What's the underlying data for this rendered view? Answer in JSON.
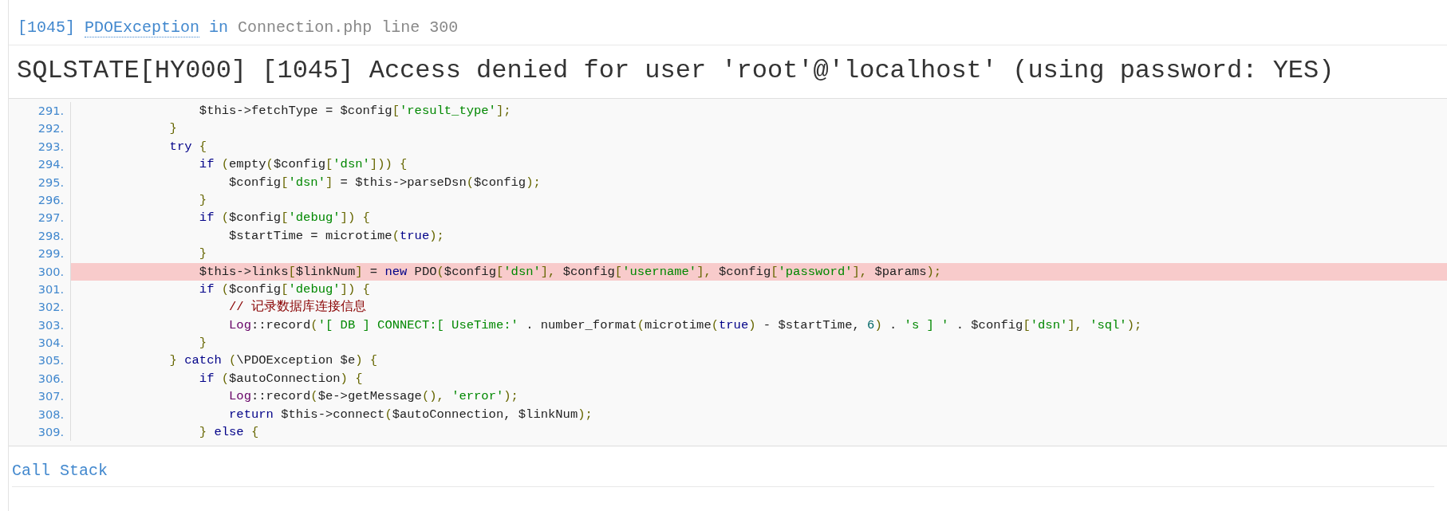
{
  "exception_header": {
    "code": "[1045]",
    "exception": "PDOException",
    "connector": "in",
    "location": "Connection.php line 300"
  },
  "message": "SQLSTATE[HY000] [1045] Access denied for user 'root'@'localhost' (using password: YES)",
  "source_lines": [
    {
      "number": "291.",
      "highlighted": false,
      "tokens": [
        {
          "kind": "pln",
          "text": "                $this->fetchType = $config"
        },
        {
          "kind": "pun",
          "text": "["
        },
        {
          "kind": "str",
          "text": "'result_type'"
        },
        {
          "kind": "pun",
          "text": "];"
        }
      ]
    },
    {
      "number": "292.",
      "highlighted": false,
      "tokens": [
        {
          "kind": "pun",
          "text": "            }"
        }
      ]
    },
    {
      "number": "293.",
      "highlighted": false,
      "tokens": [
        {
          "kind": "kwd",
          "text": "            try "
        },
        {
          "kind": "pun",
          "text": "{"
        }
      ]
    },
    {
      "number": "294.",
      "highlighted": false,
      "tokens": [
        {
          "kind": "kwd",
          "text": "                if "
        },
        {
          "kind": "pun",
          "text": "("
        },
        {
          "kind": "pln",
          "text": "empty"
        },
        {
          "kind": "pun",
          "text": "("
        },
        {
          "kind": "pln",
          "text": "$config"
        },
        {
          "kind": "pun",
          "text": "["
        },
        {
          "kind": "str",
          "text": "'dsn'"
        },
        {
          "kind": "pun",
          "text": "])) {"
        }
      ]
    },
    {
      "number": "295.",
      "highlighted": false,
      "tokens": [
        {
          "kind": "pln",
          "text": "                    $config"
        },
        {
          "kind": "pun",
          "text": "["
        },
        {
          "kind": "str",
          "text": "'dsn'"
        },
        {
          "kind": "pun",
          "text": "]"
        },
        {
          "kind": "pln",
          "text": " = $this->parseDsn"
        },
        {
          "kind": "pun",
          "text": "("
        },
        {
          "kind": "pln",
          "text": "$config"
        },
        {
          "kind": "pun",
          "text": ");"
        }
      ]
    },
    {
      "number": "296.",
      "highlighted": false,
      "tokens": [
        {
          "kind": "pun",
          "text": "                }"
        }
      ]
    },
    {
      "number": "297.",
      "highlighted": false,
      "tokens": [
        {
          "kind": "kwd",
          "text": "                if "
        },
        {
          "kind": "pun",
          "text": "("
        },
        {
          "kind": "pln",
          "text": "$config"
        },
        {
          "kind": "pun",
          "text": "["
        },
        {
          "kind": "str",
          "text": "'debug'"
        },
        {
          "kind": "pun",
          "text": "]) {"
        }
      ]
    },
    {
      "number": "298.",
      "highlighted": false,
      "tokens": [
        {
          "kind": "pln",
          "text": "                    $startTime = microtime"
        },
        {
          "kind": "pun",
          "text": "("
        },
        {
          "kind": "kwd",
          "text": "true"
        },
        {
          "kind": "pun",
          "text": ");"
        }
      ]
    },
    {
      "number": "299.",
      "highlighted": false,
      "tokens": [
        {
          "kind": "pun",
          "text": "                }"
        }
      ]
    },
    {
      "number": "300.",
      "highlighted": true,
      "tokens": [
        {
          "kind": "pln",
          "text": "                $this->links"
        },
        {
          "kind": "pun",
          "text": "["
        },
        {
          "kind": "pln",
          "text": "$linkNum"
        },
        {
          "kind": "pun",
          "text": "]"
        },
        {
          "kind": "pln",
          "text": " = "
        },
        {
          "kind": "kwd",
          "text": "new"
        },
        {
          "kind": "pln",
          "text": " PDO"
        },
        {
          "kind": "pun",
          "text": "("
        },
        {
          "kind": "pln",
          "text": "$config"
        },
        {
          "kind": "pun",
          "text": "["
        },
        {
          "kind": "str",
          "text": "'dsn'"
        },
        {
          "kind": "pun",
          "text": "],"
        },
        {
          "kind": "pln",
          "text": " $config"
        },
        {
          "kind": "pun",
          "text": "["
        },
        {
          "kind": "str",
          "text": "'username'"
        },
        {
          "kind": "pun",
          "text": "],"
        },
        {
          "kind": "pln",
          "text": " $config"
        },
        {
          "kind": "pun",
          "text": "["
        },
        {
          "kind": "str",
          "text": "'password'"
        },
        {
          "kind": "pun",
          "text": "],"
        },
        {
          "kind": "pln",
          "text": " $params"
        },
        {
          "kind": "pun",
          "text": ");"
        }
      ]
    },
    {
      "number": "301.",
      "highlighted": false,
      "tokens": [
        {
          "kind": "kwd",
          "text": "                if "
        },
        {
          "kind": "pun",
          "text": "("
        },
        {
          "kind": "pln",
          "text": "$config"
        },
        {
          "kind": "pun",
          "text": "["
        },
        {
          "kind": "str",
          "text": "'debug'"
        },
        {
          "kind": "pun",
          "text": "]) {"
        }
      ]
    },
    {
      "number": "302.",
      "highlighted": false,
      "tokens": [
        {
          "kind": "com",
          "text": "                    // 记录数据库连接信息"
        }
      ]
    },
    {
      "number": "303.",
      "highlighted": false,
      "tokens": [
        {
          "kind": "typ",
          "text": "                    Log"
        },
        {
          "kind": "pln",
          "text": "::record"
        },
        {
          "kind": "pun",
          "text": "("
        },
        {
          "kind": "str",
          "text": "'[ DB ] CONNECT:[ UseTime:'"
        },
        {
          "kind": "pln",
          "text": " . number_format"
        },
        {
          "kind": "pun",
          "text": "("
        },
        {
          "kind": "pln",
          "text": "microtime"
        },
        {
          "kind": "pun",
          "text": "("
        },
        {
          "kind": "kwd",
          "text": "true"
        },
        {
          "kind": "pun",
          "text": ")"
        },
        {
          "kind": "pln",
          "text": " - $startTime, "
        },
        {
          "kind": "lit",
          "text": "6"
        },
        {
          "kind": "pun",
          "text": ")"
        },
        {
          "kind": "pln",
          "text": " . "
        },
        {
          "kind": "str",
          "text": "'s ] '"
        },
        {
          "kind": "pln",
          "text": " . $config"
        },
        {
          "kind": "pun",
          "text": "["
        },
        {
          "kind": "str",
          "text": "'dsn'"
        },
        {
          "kind": "pun",
          "text": "], "
        },
        {
          "kind": "str",
          "text": "'sql'"
        },
        {
          "kind": "pun",
          "text": ");"
        }
      ]
    },
    {
      "number": "304.",
      "highlighted": false,
      "tokens": [
        {
          "kind": "pun",
          "text": "                }"
        }
      ]
    },
    {
      "number": "305.",
      "highlighted": false,
      "tokens": [
        {
          "kind": "pun",
          "text": "            } "
        },
        {
          "kind": "kwd",
          "text": "catch "
        },
        {
          "kind": "pun",
          "text": "("
        },
        {
          "kind": "pln",
          "text": "\\PDOException $e"
        },
        {
          "kind": "pun",
          "text": ") {"
        }
      ]
    },
    {
      "number": "306.",
      "highlighted": false,
      "tokens": [
        {
          "kind": "kwd",
          "text": "                if "
        },
        {
          "kind": "pun",
          "text": "("
        },
        {
          "kind": "pln",
          "text": "$autoConnection"
        },
        {
          "kind": "pun",
          "text": ") {"
        }
      ]
    },
    {
      "number": "307.",
      "highlighted": false,
      "tokens": [
        {
          "kind": "typ",
          "text": "                    Log"
        },
        {
          "kind": "pln",
          "text": "::record"
        },
        {
          "kind": "pun",
          "text": "("
        },
        {
          "kind": "pln",
          "text": "$e->getMessage"
        },
        {
          "kind": "pun",
          "text": "(), "
        },
        {
          "kind": "str",
          "text": "'error'"
        },
        {
          "kind": "pun",
          "text": ");"
        }
      ]
    },
    {
      "number": "308.",
      "highlighted": false,
      "tokens": [
        {
          "kind": "kwd",
          "text": "                    return"
        },
        {
          "kind": "pln",
          "text": " $this->connect"
        },
        {
          "kind": "pun",
          "text": "("
        },
        {
          "kind": "pln",
          "text": "$autoConnection, $linkNum"
        },
        {
          "kind": "pun",
          "text": ");"
        }
      ]
    },
    {
      "number": "309.",
      "highlighted": false,
      "tokens": [
        {
          "kind": "pun",
          "text": "                } "
        },
        {
          "kind": "kwd",
          "text": "else "
        },
        {
          "kind": "pun",
          "text": "{"
        }
      ]
    }
  ],
  "call_stack": {
    "title": "Call Stack"
  }
}
